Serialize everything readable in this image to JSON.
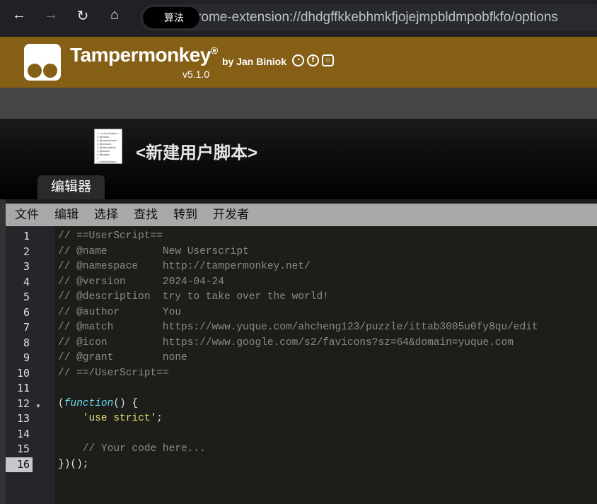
{
  "browser": {
    "back": "←",
    "forward": "→",
    "reload": "↻",
    "home": "⌂",
    "chip": "算法",
    "url": "chrome-extension://dhdgffkkebhmkfjojejmpbldmpobfkfo/options"
  },
  "header": {
    "title": "Tampermonkey",
    "reg": "®",
    "by": "by Jan Biniok",
    "version": "v5.1.0"
  },
  "script": {
    "title": "<新建用户脚本>"
  },
  "tabs": [
    {
      "label": "编辑器"
    }
  ],
  "menu": [
    "文件",
    "编辑",
    "选择",
    "查找",
    "转到",
    "开发者"
  ],
  "editor": {
    "active_line": 16,
    "lines": [
      "// ==UserScript==",
      "// @name         New Userscript",
      "// @namespace    http://tampermonkey.net/",
      "// @version      2024-04-24",
      "// @description  try to take over the world!",
      "// @author       You",
      "// @match        https://www.yuque.com/ahcheng123/puzzle/ittab3005u0fy8qu/edit",
      "// @icon         https://www.google.com/s2/favicons?sz=64&domain=yuque.com",
      "// @grant        none",
      "// ==/UserScript==",
      "",
      "(function() {",
      "    'use strict';",
      "",
      "    // Your code here...",
      "})();"
    ]
  },
  "colors": {
    "header": "#865f17",
    "comment": "#8b8a7c",
    "keyword": "#66d9ef",
    "string": "#e6db74"
  }
}
